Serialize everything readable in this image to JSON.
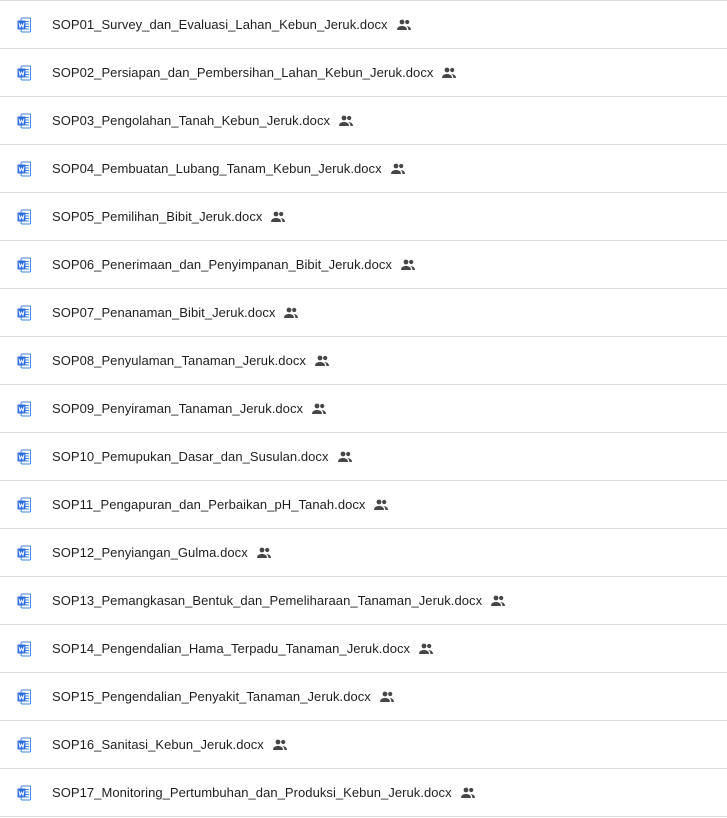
{
  "files": [
    {
      "name": "SOP01_Survey_dan_Evaluasi_Lahan_Kebun_Jeruk.docx",
      "icon": "word-doc-icon",
      "shared_icon": "shared-people-icon"
    },
    {
      "name": "SOP02_Persiapan_dan_Pembersihan_Lahan_Kebun_Jeruk.docx",
      "icon": "word-doc-icon",
      "shared_icon": "shared-people-icon"
    },
    {
      "name": "SOP03_Pengolahan_Tanah_Kebun_Jeruk.docx",
      "icon": "word-doc-icon",
      "shared_icon": "shared-people-icon"
    },
    {
      "name": "SOP04_Pembuatan_Lubang_Tanam_Kebun_Jeruk.docx",
      "icon": "word-doc-icon",
      "shared_icon": "shared-people-icon"
    },
    {
      "name": "SOP05_Pemilihan_Bibit_Jeruk.docx",
      "icon": "word-doc-icon",
      "shared_icon": "shared-people-icon"
    },
    {
      "name": "SOP06_Penerimaan_dan_Penyimpanan_Bibit_Jeruk.docx",
      "icon": "word-doc-icon",
      "shared_icon": "shared-people-icon"
    },
    {
      "name": "SOP07_Penanaman_Bibit_Jeruk.docx",
      "icon": "word-doc-icon",
      "shared_icon": "shared-people-icon"
    },
    {
      "name": "SOP08_Penyulaman_Tanaman_Jeruk.docx",
      "icon": "word-doc-icon",
      "shared_icon": "shared-people-icon"
    },
    {
      "name": "SOP09_Penyiraman_Tanaman_Jeruk.docx",
      "icon": "word-doc-icon",
      "shared_icon": "shared-people-icon"
    },
    {
      "name": "SOP10_Pemupukan_Dasar_dan_Susulan.docx",
      "icon": "word-doc-icon",
      "shared_icon": "shared-people-icon"
    },
    {
      "name": "SOP11_Pengapuran_dan_Perbaikan_pH_Tanah.docx",
      "icon": "word-doc-icon",
      "shared_icon": "shared-people-icon"
    },
    {
      "name": "SOP12_Penyiangan_Gulma.docx",
      "icon": "word-doc-icon",
      "shared_icon": "shared-people-icon"
    },
    {
      "name": "SOP13_Pemangkasan_Bentuk_dan_Pemeliharaan_Tanaman_Jeruk.docx",
      "icon": "word-doc-icon",
      "shared_icon": "shared-people-icon"
    },
    {
      "name": "SOP14_Pengendalian_Hama_Terpadu_Tanaman_Jeruk.docx",
      "icon": "word-doc-icon",
      "shared_icon": "shared-people-icon"
    },
    {
      "name": "SOP15_Pengendalian_Penyakit_Tanaman_Jeruk.docx",
      "icon": "word-doc-icon",
      "shared_icon": "shared-people-icon"
    },
    {
      "name": "SOP16_Sanitasi_Kebun_Jeruk.docx",
      "icon": "word-doc-icon",
      "shared_icon": "shared-people-icon"
    },
    {
      "name": "SOP17_Monitoring_Pertumbuhan_dan_Produksi_Kebun_Jeruk.docx",
      "icon": "word-doc-icon",
      "shared_icon": "shared-people-icon"
    }
  ],
  "colors": {
    "word_blue": "#4285f4",
    "divider": "#dadce0",
    "text": "#1f1f1f",
    "shared_icon": "#444746"
  }
}
